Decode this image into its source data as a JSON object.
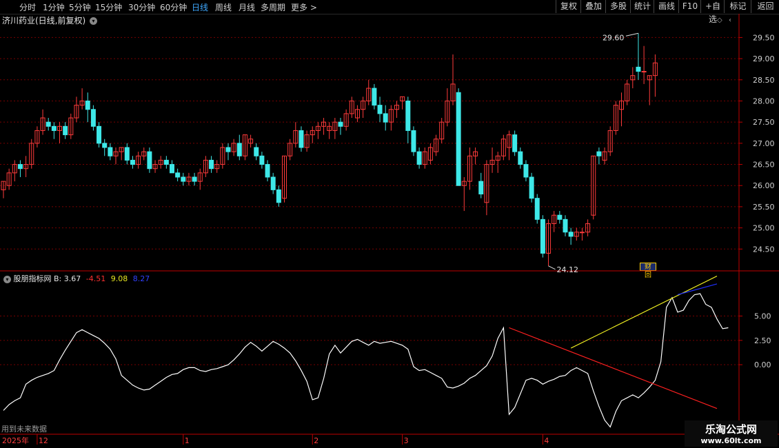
{
  "toolbar": {
    "periods": [
      "分时",
      "1分钟",
      "5分钟",
      "15分钟",
      "30分钟",
      "60分钟",
      "日线",
      "周线",
      "月线",
      "多周期",
      "更多 >"
    ],
    "active_period": "日线",
    "right_buttons": [
      "复权",
      "叠加",
      "多股",
      "统计",
      "画线",
      "F10",
      "+自选",
      "标记",
      "返回"
    ]
  },
  "price_panel": {
    "title": "济川药业(日线,前复权)",
    "high_label": "29.60",
    "low_label": "24.12",
    "fin_badge": "财 回"
  },
  "indicator_panel": {
    "name": "股朋指标网",
    "b_label": "B: 3.67",
    "v2": "-4.51",
    "v3": "9.08",
    "v4": "8.27",
    "future_note": "用到未来数据"
  },
  "date_axis": {
    "year": "2025年",
    "months": [
      "12",
      "1",
      "2",
      "3",
      "4"
    ]
  },
  "watermark": {
    "line1": "乐淘公式网",
    "line2": "www.60lt.com"
  },
  "colors": {
    "up": "#ff3b3b",
    "down": "#3ee8e8",
    "grid": "#7a0000",
    "axis": "#c00000",
    "white_line": "#ffffff",
    "yellow": "#e8e820",
    "red_line": "#ff2020",
    "blue": "#2030ff"
  },
  "chart_data": [
    {
      "type": "candlestick",
      "title": "济川药业(日线,前复权)",
      "y_ticks": [
        24.5,
        25.0,
        25.5,
        26.0,
        26.5,
        27.0,
        27.5,
        28.0,
        28.5,
        29.0,
        29.5
      ],
      "ylim": [
        24.0,
        29.8
      ],
      "x_month_labels": [
        "12",
        "1",
        "2",
        "3",
        "4"
      ],
      "candles": [
        [
          25.9,
          26.1,
          25.7,
          26.1
        ],
        [
          26.0,
          26.4,
          25.9,
          26.3
        ],
        [
          26.3,
          26.6,
          26.1,
          26.5
        ],
        [
          26.5,
          26.6,
          26.2,
          26.4
        ],
        [
          26.4,
          26.7,
          26.2,
          26.5
        ],
        [
          26.5,
          27.1,
          26.4,
          27.0
        ],
        [
          27.0,
          27.4,
          26.9,
          27.3
        ],
        [
          27.3,
          27.8,
          27.2,
          27.6
        ],
        [
          27.5,
          27.6,
          27.3,
          27.4
        ],
        [
          27.4,
          27.5,
          27.1,
          27.3
        ],
        [
          27.3,
          27.5,
          27.0,
          27.4
        ],
        [
          27.4,
          27.5,
          27.1,
          27.2
        ],
        [
          27.2,
          27.7,
          27.1,
          27.6
        ],
        [
          27.6,
          28.1,
          27.5,
          27.9
        ],
        [
          27.9,
          28.3,
          27.8,
          28.0
        ],
        [
          28.0,
          28.2,
          27.5,
          27.8
        ],
        [
          27.8,
          27.9,
          27.3,
          27.4
        ],
        [
          27.4,
          27.5,
          26.9,
          27.0
        ],
        [
          27.0,
          27.1,
          26.7,
          26.9
        ],
        [
          26.9,
          27.0,
          26.6,
          26.7
        ],
        [
          26.7,
          26.9,
          26.5,
          26.8
        ],
        [
          26.8,
          26.9,
          26.6,
          26.9
        ],
        [
          26.9,
          27.0,
          26.5,
          26.6
        ],
        [
          26.6,
          26.7,
          26.4,
          26.5
        ],
        [
          26.5,
          26.8,
          26.4,
          26.7
        ],
        [
          26.7,
          26.9,
          26.6,
          26.8
        ],
        [
          26.8,
          26.9,
          26.3,
          26.4
        ],
        [
          26.4,
          26.6,
          26.3,
          26.5
        ],
        [
          26.5,
          26.7,
          26.4,
          26.6
        ],
        [
          26.6,
          26.7,
          26.4,
          26.5
        ],
        [
          26.5,
          26.6,
          26.3,
          26.3
        ],
        [
          26.3,
          26.4,
          26.1,
          26.2
        ],
        [
          26.2,
          26.3,
          26.0,
          26.1
        ],
        [
          26.1,
          26.3,
          26.0,
          26.2
        ],
        [
          26.2,
          26.3,
          26.0,
          26.1
        ],
        [
          26.1,
          26.4,
          25.9,
          26.3
        ],
        [
          26.3,
          26.7,
          26.2,
          26.6
        ],
        [
          26.6,
          26.7,
          26.3,
          26.4
        ],
        [
          26.4,
          26.6,
          26.3,
          26.5
        ],
        [
          26.5,
          27.0,
          26.4,
          26.9
        ],
        [
          26.9,
          27.0,
          26.6,
          26.8
        ],
        [
          26.8,
          27.1,
          26.7,
          27.0
        ],
        [
          27.0,
          27.2,
          26.6,
          26.7
        ],
        [
          26.7,
          27.2,
          26.6,
          27.2
        ],
        [
          27.0,
          27.2,
          26.9,
          27.1
        ],
        [
          26.9,
          27.0,
          26.6,
          26.7
        ],
        [
          26.7,
          26.8,
          26.4,
          26.5
        ],
        [
          26.5,
          26.6,
          26.1,
          26.2
        ],
        [
          26.2,
          26.3,
          25.8,
          25.9
        ],
        [
          25.9,
          26.0,
          25.5,
          25.6
        ],
        [
          25.7,
          26.7,
          25.6,
          26.7
        ],
        [
          26.7,
          27.1,
          26.6,
          27.0
        ],
        [
          27.0,
          27.5,
          26.9,
          27.3
        ],
        [
          27.3,
          27.4,
          26.8,
          26.9
        ],
        [
          26.9,
          27.3,
          26.8,
          27.2
        ],
        [
          27.2,
          27.4,
          27.0,
          27.3
        ],
        [
          27.3,
          27.5,
          27.1,
          27.4
        ],
        [
          27.4,
          27.6,
          27.2,
          27.5
        ],
        [
          27.3,
          27.5,
          27.1,
          27.4
        ],
        [
          27.3,
          27.6,
          27.1,
          27.5
        ],
        [
          27.5,
          27.6,
          27.2,
          27.4
        ],
        [
          27.4,
          27.8,
          27.3,
          27.7
        ],
        [
          27.7,
          28.1,
          27.6,
          28.0
        ],
        [
          27.6,
          27.9,
          27.5,
          27.8
        ],
        [
          27.8,
          28.1,
          27.6,
          28.0
        ],
        [
          28.0,
          28.5,
          27.9,
          28.3
        ],
        [
          28.3,
          28.4,
          27.8,
          27.9
        ],
        [
          27.9,
          28.1,
          27.5,
          27.7
        ],
        [
          27.7,
          27.9,
          27.3,
          27.5
        ],
        [
          27.5,
          27.9,
          27.3,
          27.8
        ],
        [
          27.8,
          28.0,
          27.6,
          27.9
        ],
        [
          28.0,
          28.1,
          27.8,
          28.1
        ],
        [
          28.0,
          28.1,
          27.0,
          27.3
        ],
        [
          27.3,
          27.4,
          26.7,
          26.8
        ],
        [
          26.8,
          26.9,
          26.4,
          26.5
        ],
        [
          26.5,
          26.9,
          26.4,
          26.8
        ],
        [
          26.6,
          27.0,
          26.5,
          26.9
        ],
        [
          26.8,
          27.2,
          26.7,
          27.1
        ],
        [
          27.1,
          27.6,
          27.0,
          27.5
        ],
        [
          27.5,
          28.3,
          27.4,
          28.0
        ],
        [
          28.0,
          29.1,
          27.9,
          28.4
        ],
        [
          28.2,
          28.3,
          26.0,
          26.0
        ],
        [
          26.0,
          26.2,
          25.4,
          26.1
        ],
        [
          26.1,
          26.9,
          25.9,
          26.7
        ],
        [
          26.7,
          26.9,
          26.5,
          26.8
        ],
        [
          26.1,
          26.3,
          25.7,
          25.8
        ],
        [
          25.6,
          26.6,
          25.3,
          26.5
        ],
        [
          26.5,
          26.9,
          26.3,
          26.6
        ],
        [
          26.6,
          26.8,
          26.3,
          26.7
        ],
        [
          26.7,
          27.2,
          26.6,
          27.1
        ],
        [
          26.9,
          27.3,
          26.6,
          27.2
        ],
        [
          27.2,
          27.3,
          26.7,
          26.8
        ],
        [
          26.8,
          26.9,
          26.4,
          26.5
        ],
        [
          26.5,
          26.6,
          26.1,
          26.2
        ],
        [
          26.2,
          26.3,
          25.6,
          25.7
        ],
        [
          25.7,
          25.8,
          25.1,
          25.2
        ],
        [
          25.2,
          25.3,
          24.3,
          24.4
        ],
        [
          24.4,
          25.2,
          24.1,
          25.1
        ],
        [
          25.1,
          25.4,
          24.9,
          25.3
        ],
        [
          25.3,
          25.4,
          25.1,
          25.2
        ],
        [
          25.2,
          25.3,
          24.8,
          24.9
        ],
        [
          24.9,
          25.0,
          24.6,
          24.8
        ],
        [
          24.8,
          25.0,
          24.7,
          24.9
        ],
        [
          24.9,
          25.0,
          24.7,
          24.9
        ],
        [
          24.9,
          25.2,
          24.8,
          25.1
        ],
        [
          25.3,
          26.7,
          25.2,
          26.7
        ],
        [
          26.8,
          26.9,
          26.5,
          26.7
        ],
        [
          26.6,
          26.9,
          26.5,
          26.8
        ],
        [
          26.8,
          27.4,
          26.7,
          27.3
        ],
        [
          27.3,
          28.0,
          27.2,
          27.9
        ],
        [
          27.8,
          28.2,
          27.4,
          28.0
        ],
        [
          28.0,
          28.5,
          27.9,
          28.4
        ],
        [
          28.5,
          28.8,
          28.3,
          28.6
        ],
        [
          28.8,
          29.6,
          28.5,
          28.7
        ],
        [
          28.7,
          29.3,
          28.4,
          28.7
        ],
        [
          28.5,
          28.6,
          27.9,
          28.6
        ],
        [
          28.6,
          29.1,
          28.1,
          28.9
        ]
      ]
    },
    {
      "type": "line",
      "name": "股朋指标网",
      "y_ticks": [
        0.0,
        2.5,
        5.0
      ],
      "ylim": [
        -7.0,
        9.5
      ],
      "series": [
        {
          "name": "B",
          "color": "#ffffff",
          "values": [
            -4.7,
            -4.1,
            -3.7,
            -3.4,
            -2.0,
            -1.6,
            -1.3,
            -1.1,
            -0.9,
            -0.6,
            0.5,
            1.5,
            2.4,
            3.3,
            3.6,
            3.3,
            3.0,
            2.7,
            2.2,
            1.6,
            0.6,
            -1.1,
            -1.6,
            -2.1,
            -2.4,
            -2.6,
            -2.5,
            -2.1,
            -1.7,
            -1.3,
            -1.0,
            -0.9,
            -0.5,
            -0.3,
            -0.3,
            -0.6,
            -0.7,
            -0.5,
            -0.4,
            -0.2,
            0.0,
            0.5,
            1.1,
            1.8,
            2.3,
            1.9,
            1.4,
            1.9,
            2.4,
            2.1,
            1.7,
            1.2,
            0.4,
            -0.6,
            -1.7,
            -3.6,
            -3.4,
            -1.4,
            1.1,
            2.0,
            1.2,
            1.8,
            2.4,
            2.6,
            2.3,
            2.0,
            2.4,
            2.2,
            2.3,
            2.4,
            2.2,
            2.0,
            1.6,
            -0.2,
            -0.6,
            -0.5,
            -0.8,
            -1.1,
            -1.4,
            -2.3,
            -2.4,
            -2.2,
            -1.9,
            -1.4,
            -1.1,
            -0.6,
            -0.1,
            0.9,
            2.7,
            3.8,
            -5.1,
            -4.4,
            -3.0,
            -1.6,
            -1.4,
            -1.6,
            -2.0,
            -1.7,
            -1.5,
            -1.2,
            -1.1,
            -0.6,
            -0.3,
            -0.6,
            -0.9,
            -2.7,
            -4.3,
            -5.7,
            -6.4,
            -4.8,
            -3.7,
            -3.4,
            -3.1,
            -3.4,
            -2.9,
            -2.3,
            -1.6,
            0.3,
            5.9,
            6.9,
            5.4,
            5.6,
            6.6,
            7.2,
            7.3,
            6.2,
            5.9,
            4.7,
            3.7,
            3.8
          ]
        },
        {
          "name": "red line",
          "color": "#ff2020",
          "points": [
            [
              90,
              3.8
            ],
            [
              127,
              -4.5
            ]
          ]
        },
        {
          "name": "yellow line",
          "color": "#e8e820",
          "points": [
            [
              101,
              1.7
            ],
            [
              127,
              9.1
            ]
          ]
        },
        {
          "name": "blue line",
          "color": "#2030ff",
          "points": [
            [
              120,
              7.2
            ],
            [
              127,
              8.3
            ]
          ]
        }
      ]
    }
  ]
}
